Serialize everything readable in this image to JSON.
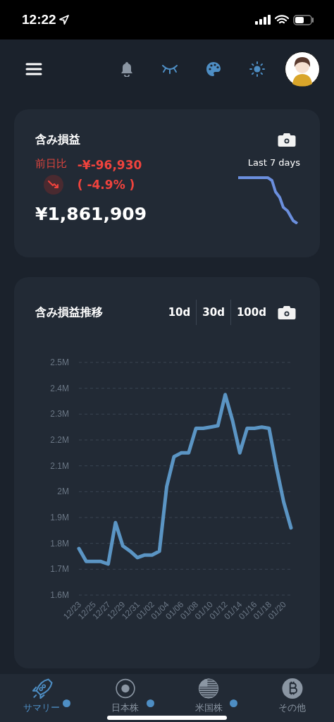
{
  "status_bar": {
    "time": "12:22"
  },
  "summary_card": {
    "title": "含み損益",
    "compare_label": "前日比",
    "change_amount": "-¥-96,930",
    "change_percent": "( -4.9% )",
    "total": "¥1,861,909",
    "sparkline_label": "Last 7 days"
  },
  "trend_card": {
    "title": "含み損益推移",
    "periods": [
      "10d",
      "30d",
      "100d"
    ],
    "chart_data": {
      "type": "line",
      "categories": [
        "12/23",
        null,
        "12/25",
        null,
        "12/27",
        null,
        "12/29",
        null,
        "12/31",
        null,
        "01/02",
        null,
        "01/04",
        null,
        "01/06",
        null,
        "01/08",
        null,
        "01/10",
        null,
        "01/12",
        null,
        "01/14",
        null,
        "01/16",
        null,
        "01/18",
        null,
        "01/20",
        null
      ],
      "series": [
        {
          "color": "#5b95c4",
          "values": [
            1.78,
            1.73,
            1.73,
            1.73,
            1.72,
            1.88,
            1.79,
            1.77,
            1.745,
            1.755,
            1.755,
            1.77,
            2.02,
            2.135,
            2.15,
            2.15,
            2.245,
            2.245,
            2.25,
            2.255,
            2.375,
            2.275,
            2.15,
            2.245,
            2.245,
            2.25,
            2.245,
            2.095,
            1.96,
            1.86
          ]
        }
      ],
      "ylim": [
        1.6,
        2.5
      ],
      "grid": true,
      "yticks": [
        {
          "value": 1.6,
          "label": "1.6M"
        },
        {
          "value": 1.7,
          "label": "1.7M"
        },
        {
          "value": 1.8,
          "label": "1.8M"
        },
        {
          "value": 1.9,
          "label": "1.9M"
        },
        {
          "value": 2.0,
          "label": "2M"
        },
        {
          "value": 2.1,
          "label": "2.1M"
        },
        {
          "value": 2.2,
          "label": "2.2M"
        },
        {
          "value": 2.3,
          "label": "2.3M"
        },
        {
          "value": 2.4,
          "label": "2.4M"
        },
        {
          "value": 2.5,
          "label": "2.5M"
        }
      ]
    }
  },
  "tab_bar": [
    {
      "kind": "rocket",
      "label": "サマリー",
      "selected": true,
      "dot": true
    },
    {
      "kind": "target",
      "label": "日本株",
      "selected": false,
      "dot": true
    },
    {
      "kind": "flag",
      "label": "米国株",
      "selected": false,
      "dot": true
    },
    {
      "kind": "bitcoin",
      "label": "その他",
      "selected": false,
      "dot": false
    }
  ]
}
